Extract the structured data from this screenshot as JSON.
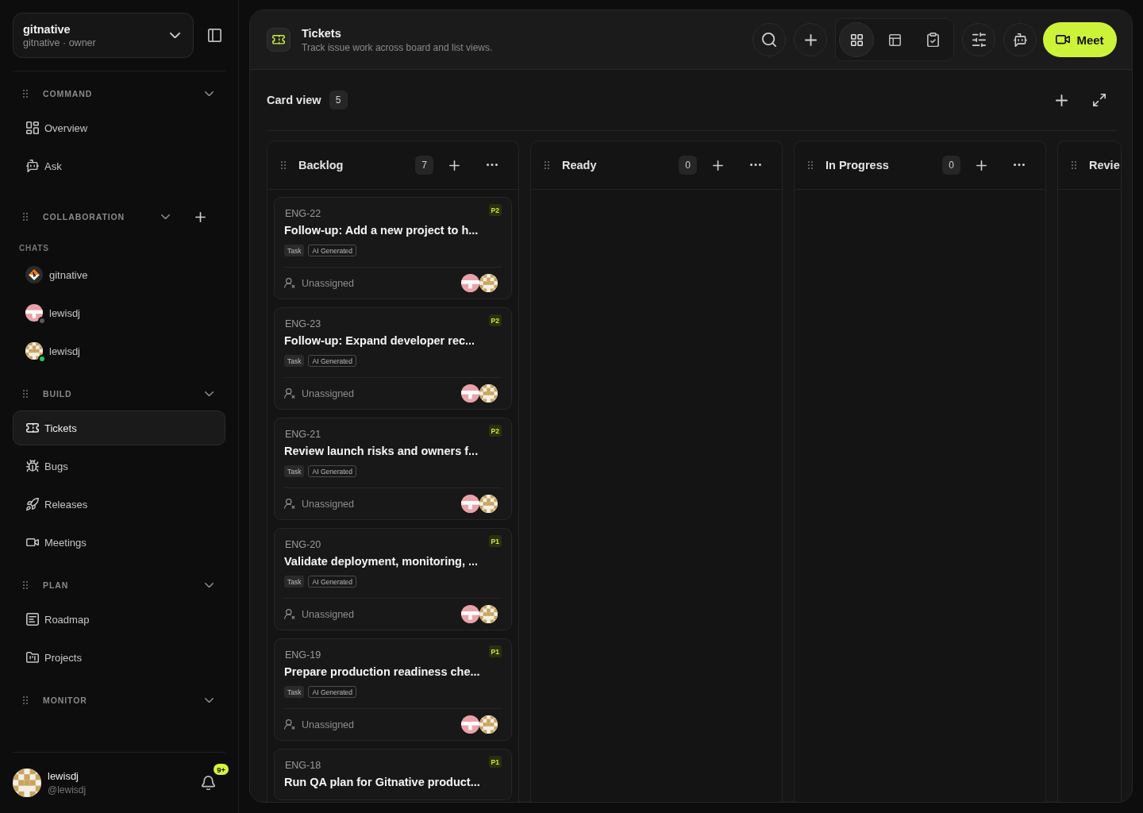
{
  "sidebar": {
    "workspace": {
      "name": "gitnative",
      "subtitle": "gitnative · owner"
    },
    "sections": [
      {
        "title": "COMMAND",
        "kind": "nav",
        "items": [
          {
            "label": "Overview",
            "kind": "overview",
            "selected": false
          },
          {
            "label": "Ask",
            "kind": "ask",
            "selected": false
          }
        ]
      },
      {
        "title": "COLLABORATION",
        "kind": "chats",
        "group": "CHATS",
        "chats": [
          {
            "name": "gitnative",
            "kind": "logo"
          },
          {
            "name": "lewisdj",
            "kind": "bars",
            "color": "#5a5a5a"
          },
          {
            "name": "lewisdj",
            "kind": "checker",
            "color": "#22c55e"
          }
        ]
      },
      {
        "title": "BUILD",
        "kind": "nav",
        "items": [
          {
            "label": "Tickets",
            "kind": "tickets",
            "selected": true
          },
          {
            "label": "Bugs",
            "kind": "bugs",
            "selected": false
          },
          {
            "label": "Releases",
            "kind": "releases",
            "selected": false
          },
          {
            "label": "Meetings",
            "kind": "meetings",
            "selected": false
          }
        ]
      },
      {
        "title": "PLAN",
        "kind": "nav",
        "items": [
          {
            "label": "Roadmap",
            "kind": "roadmap",
            "selected": false
          },
          {
            "label": "Projects",
            "kind": "projects",
            "selected": false
          }
        ]
      },
      {
        "title": "MONITOR",
        "kind": "nav"
      }
    ],
    "user": {
      "name": "lewisdj",
      "handle": "@lewisdj",
      "notifications": "9+"
    }
  },
  "page": {
    "title": "Tickets",
    "subtitle": "Track issue work across board and list views.",
    "views": [
      {
        "kind": "grid",
        "selected": true
      },
      {
        "kind": "table",
        "selected": false
      },
      {
        "kind": "checklist",
        "selected": false
      }
    ],
    "meet_button": "Meet"
  },
  "board": {
    "title": "Card view",
    "count": "5",
    "columns": [
      {
        "title": "Backlog",
        "count": "7",
        "cards": [
          {
            "id": "ENG-22",
            "priority": "P2",
            "title": "Follow-up: Add a new project to h...",
            "tags": [
              {
                "label": "Task",
                "kind": "type"
              },
              {
                "label": "AI Generated",
                "kind": "source"
              }
            ],
            "assignee": "Unassigned"
          },
          {
            "id": "ENG-23",
            "priority": "P2",
            "title": "Follow-up: Expand developer rec...",
            "tags": [
              {
                "label": "Task",
                "kind": "type"
              },
              {
                "label": "AI Generated",
                "kind": "source"
              }
            ],
            "assignee": "Unassigned"
          },
          {
            "id": "ENG-21",
            "priority": "P2",
            "title": "Review launch risks and owners f...",
            "tags": [
              {
                "label": "Task",
                "kind": "type"
              },
              {
                "label": "AI Generated",
                "kind": "source"
              }
            ],
            "assignee": "Unassigned"
          },
          {
            "id": "ENG-20",
            "priority": "P1",
            "title": "Validate deployment, monitoring, ...",
            "tags": [
              {
                "label": "Task",
                "kind": "type"
              },
              {
                "label": "AI Generated",
                "kind": "source"
              }
            ],
            "assignee": "Unassigned"
          },
          {
            "id": "ENG-19",
            "priority": "P1",
            "title": "Prepare production readiness che...",
            "tags": [
              {
                "label": "Task",
                "kind": "type"
              },
              {
                "label": "AI Generated",
                "kind": "source"
              }
            ],
            "assignee": "Unassigned"
          },
          {
            "id": "ENG-18",
            "priority": "P1",
            "title": "Run QA plan for Gitnative product..."
          }
        ]
      },
      {
        "title": "Ready",
        "count": "0"
      },
      {
        "title": "In Progress",
        "count": "0"
      },
      {
        "title": "Revie"
      }
    ]
  }
}
